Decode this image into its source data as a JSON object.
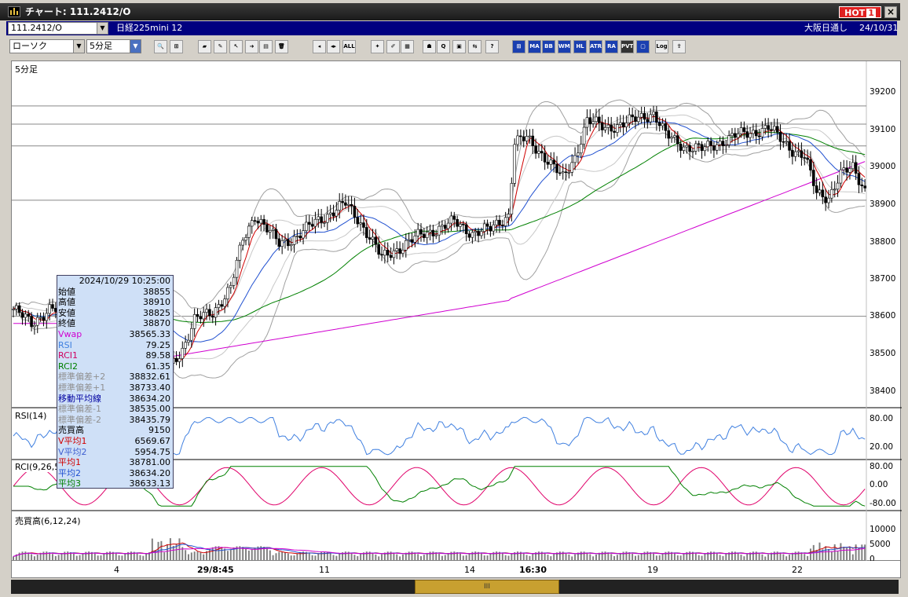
{
  "window": {
    "title": "チャート: 111.2412/O",
    "hot_label": "HOT",
    "hot_count": "1",
    "close_glyph": "×"
  },
  "infobar": {
    "symbol": "111.2412/O",
    "contract": "日経225mini 12",
    "exchange": "大阪日通し",
    "date": "24/10/31"
  },
  "toolbar": {
    "chart_type": "ローソク",
    "period": "5分足",
    "tools": [
      "zoom",
      "cursor",
      "draw-line",
      "erase",
      "pointer",
      "arrow",
      "save",
      "delete",
      "left",
      "center",
      "all",
      "settings",
      "color",
      "palette",
      "bear",
      "search",
      "image",
      "rgb",
      "help",
      "ma-table",
      "ma",
      "bb",
      "wma",
      "hl",
      "atr",
      "ra",
      "pvt",
      "box",
      "log",
      "export"
    ],
    "tool_labels": [
      "🔍",
      "⊞",
      "▰",
      "✎",
      "↖",
      "➜",
      "▤",
      "🗑",
      "◂",
      "◂▸",
      "ALL",
      "✦",
      "✐",
      "▦",
      "☗",
      "Q",
      "▣",
      "⇆",
      "?",
      "⊞",
      "MA",
      "BB",
      "WMA",
      "HL",
      "ATR",
      "RA",
      "PVT",
      "▢",
      "Log",
      "⇪"
    ]
  },
  "panels": {
    "main": "5分足",
    "rsi": "RSI(14)",
    "rci": "RCI(9,26,52)",
    "volume": "売買高(6,12,24)"
  },
  "y_axis_main": [
    "39200",
    "39100",
    "39000",
    "38900",
    "38800",
    "38700",
    "38600",
    "38500",
    "38400"
  ],
  "y_axis_rsi": [
    "80.00",
    "20.00"
  ],
  "y_axis_rci": [
    "80.00",
    "0.00",
    "-80.00"
  ],
  "y_axis_vol": [
    "10000",
    "5000",
    "0"
  ],
  "x_axis": [
    {
      "label": "4",
      "bold": false
    },
    {
      "label": "29/8:45",
      "bold": true
    },
    {
      "label": "11",
      "bold": false
    },
    {
      "label": "14",
      "bold": false
    },
    {
      "label": "16:30",
      "bold": true
    },
    {
      "label": "19",
      "bold": false
    },
    {
      "label": "22",
      "bold": false
    }
  ],
  "scroll_glyph": "III",
  "tooltip": {
    "datetime": "2024/10/29  10:25:00",
    "rows": [
      {
        "k": "始値",
        "v": "38855",
        "c": "#000000"
      },
      {
        "k": "高値",
        "v": "38910",
        "c": "#000000"
      },
      {
        "k": "安値",
        "v": "38825",
        "c": "#000000"
      },
      {
        "k": "終値",
        "v": "38870",
        "c": "#000000"
      },
      {
        "k": "Vwap",
        "v": "38565.33",
        "c": "#d000d0"
      },
      {
        "k": "RSI",
        "v": "79.25",
        "c": "#4080e0"
      },
      {
        "k": "RCI1",
        "v": "89.58",
        "c": "#d00060"
      },
      {
        "k": "RCI2",
        "v": "61.35",
        "c": "#008000"
      },
      {
        "k": "標準偏差+2",
        "v": "38832.61",
        "c": "#909090"
      },
      {
        "k": "標準偏差+1",
        "v": "38733.40",
        "c": "#909090"
      },
      {
        "k": "移動平均線",
        "v": "38634.20",
        "c": "#0000a0"
      },
      {
        "k": "標準偏差-1",
        "v": "38535.00",
        "c": "#909090"
      },
      {
        "k": "標準偏差-2",
        "v": "38435.79",
        "c": "#909090"
      },
      {
        "k": "売買高",
        "v": "9150",
        "c": "#000000"
      },
      {
        "k": "V平均1",
        "v": "6569.67",
        "c": "#d00000"
      },
      {
        "k": "V平均2",
        "v": "5954.75",
        "c": "#4060d0"
      },
      {
        "k": "平均1",
        "v": "38781.00",
        "c": "#d00000"
      },
      {
        "k": "平均2",
        "v": "38634.20",
        "c": "#2050d0"
      },
      {
        "k": "平均3",
        "v": "38633.13",
        "c": "#008000"
      }
    ]
  },
  "colors": {
    "up": "#ffffff",
    "down": "#000000",
    "ma1": "#d00000",
    "ma2": "#2050d0",
    "ma3": "#008000",
    "vwap": "#d000d0",
    "bb": "#a0a0a0",
    "rsi": "#4080e0",
    "rci1": "#e0006a",
    "rci2": "#008000"
  },
  "chart_data": {
    "type": "candlestick",
    "series_anchors": [
      {
        "i": 0,
        "p": 38640
      },
      {
        "i": 6,
        "p": 38600
      },
      {
        "i": 12,
        "p": 38640
      },
      {
        "i": 20,
        "p": 38630
      },
      {
        "i": 30,
        "p": 38640
      },
      {
        "i": 38,
        "p": 38630
      },
      {
        "i": 44,
        "p": 38610
      },
      {
        "i": 48,
        "p": 38520
      },
      {
        "i": 52,
        "p": 38480
      },
      {
        "i": 56,
        "p": 38530
      },
      {
        "i": 60,
        "p": 38610
      },
      {
        "i": 66,
        "p": 38630
      },
      {
        "i": 72,
        "p": 38700
      },
      {
        "i": 76,
        "p": 38830
      },
      {
        "i": 80,
        "p": 38900
      },
      {
        "i": 84,
        "p": 38860
      },
      {
        "i": 88,
        "p": 38820
      },
      {
        "i": 94,
        "p": 38840
      },
      {
        "i": 100,
        "p": 38880
      },
      {
        "i": 106,
        "p": 38910
      },
      {
        "i": 110,
        "p": 38930
      },
      {
        "i": 114,
        "p": 38890
      },
      {
        "i": 118,
        "p": 38840
      },
      {
        "i": 122,
        "p": 38780
      },
      {
        "i": 128,
        "p": 38810
      },
      {
        "i": 134,
        "p": 38840
      },
      {
        "i": 140,
        "p": 38860
      },
      {
        "i": 146,
        "p": 38880
      },
      {
        "i": 152,
        "p": 38850
      },
      {
        "i": 158,
        "p": 38860
      },
      {
        "i": 164,
        "p": 38900
      },
      {
        "i": 166,
        "p": 39100
      },
      {
        "i": 170,
        "p": 39110
      },
      {
        "i": 176,
        "p": 39060
      },
      {
        "i": 182,
        "p": 39000
      },
      {
        "i": 186,
        "p": 39060
      },
      {
        "i": 190,
        "p": 39160
      },
      {
        "i": 196,
        "p": 39140
      },
      {
        "i": 202,
        "p": 39150
      },
      {
        "i": 208,
        "p": 39170
      },
      {
        "i": 212,
        "p": 39180
      },
      {
        "i": 216,
        "p": 39120
      },
      {
        "i": 222,
        "p": 39090
      },
      {
        "i": 228,
        "p": 39080
      },
      {
        "i": 234,
        "p": 39100
      },
      {
        "i": 240,
        "p": 39120
      },
      {
        "i": 246,
        "p": 39130
      },
      {
        "i": 250,
        "p": 39140
      },
      {
        "i": 254,
        "p": 39110
      },
      {
        "i": 258,
        "p": 39080
      },
      {
        "i": 262,
        "p": 39060
      },
      {
        "i": 266,
        "p": 38960
      },
      {
        "i": 270,
        "p": 38950
      },
      {
        "i": 274,
        "p": 39010
      },
      {
        "i": 278,
        "p": 39030
      },
      {
        "i": 282,
        "p": 38970
      }
    ],
    "bar_count": 283,
    "session_break_indexes": [
      46,
      165
    ],
    "y_range_main": [
      38370,
      39280
    ],
    "volume_range": [
      0,
      12000
    ],
    "hlines_main": [
      39200,
      39150,
      39090,
      38940,
      38620
    ]
  }
}
